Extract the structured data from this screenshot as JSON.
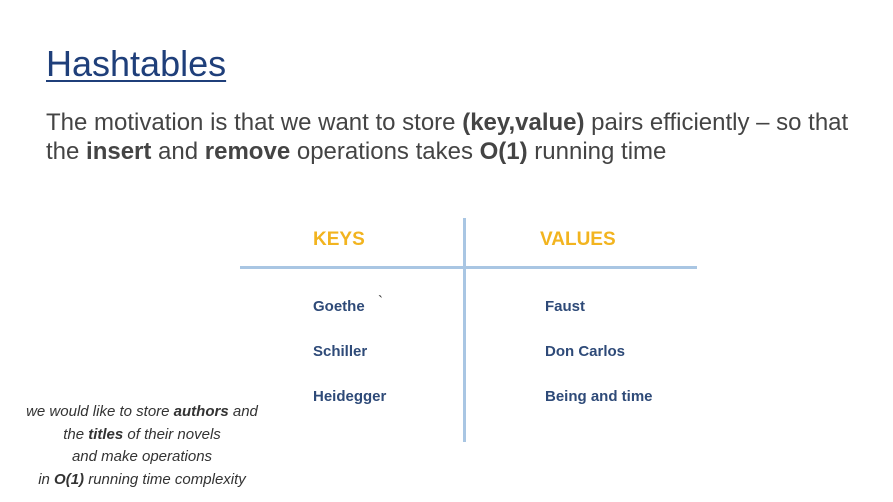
{
  "slide": {
    "title": "Hashtables",
    "motivation": {
      "p1": "The motivation is that we want to store ",
      "b1": "(key,value)",
      "p2": " pairs efficiently – so that the ",
      "b2": "insert",
      "p3": " and ",
      "b3": "remove",
      "p4": " operations takes ",
      "b4": "O(1)",
      "p5": " running time"
    },
    "table": {
      "headers": {
        "keys": "KEYS",
        "values": "VALUES"
      },
      "rows": [
        {
          "key": "Goethe",
          "value": "Faust"
        },
        {
          "key": "Schiller",
          "value": "Don Carlos"
        },
        {
          "key": "Heidegger",
          "value": "Being and time"
        }
      ],
      "stray_mark": "`"
    },
    "note": {
      "l1a": "we would like to store ",
      "l1b": "authors",
      "l1c": " and",
      "l2a": "the ",
      "l2b": "titles",
      "l2c": " of their novels",
      "l3": "and make operations",
      "l4a": "in ",
      "l4b": "O(1)",
      "l4c": " running time complexity"
    },
    "colors": {
      "title": "#1f3f7a",
      "body_text": "#444444",
      "header_accent": "#f2b41f",
      "cell_text": "#2e4a78",
      "table_lines": "#a9c6e3"
    }
  }
}
